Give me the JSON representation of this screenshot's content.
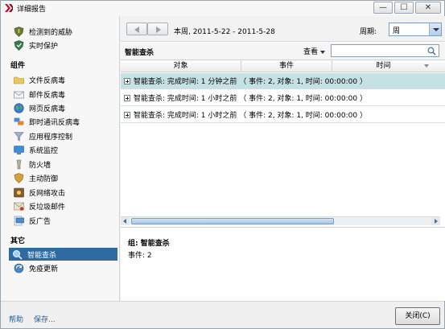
{
  "window": {
    "title": "详细报告"
  },
  "titlebar": {
    "min_glyph": "—",
    "max_glyph": "☐",
    "close_glyph": "✕"
  },
  "sidebar": {
    "top_items": [
      {
        "label": "检测到的威胁",
        "icon": "threat-shield-icon"
      },
      {
        "label": "实时保护",
        "icon": "protection-shield-icon"
      }
    ],
    "components_heading": "组件",
    "components": [
      {
        "label": "文件反病毒",
        "icon": "folder-icon"
      },
      {
        "label": "邮件反病毒",
        "icon": "mail-icon"
      },
      {
        "label": "网页反病毒",
        "icon": "globe-icon"
      },
      {
        "label": "即时通讯反病毒",
        "icon": "chat-icon"
      },
      {
        "label": "应用程序控制",
        "icon": "filter-icon"
      },
      {
        "label": "系统监控",
        "icon": "monitor-icon"
      },
      {
        "label": "防火墙",
        "icon": "firewall-icon"
      },
      {
        "label": "主动防御",
        "icon": "proactive-defense-icon"
      },
      {
        "label": "反网络攻击",
        "icon": "network-attack-icon"
      },
      {
        "label": "反垃圾邮件",
        "icon": "antispam-icon"
      },
      {
        "label": "反广告",
        "icon": "antibanner-icon"
      }
    ],
    "other_heading": "其它",
    "other": [
      {
        "label": "智能查杀",
        "icon": "scan-icon",
        "selected": true
      },
      {
        "label": "免疫更新",
        "icon": "update-icon",
        "selected": false
      }
    ]
  },
  "toolbar": {
    "period": "本周, 2011-5-22 - 2011-5-28",
    "cycle_label": "周期:",
    "cycle_value": "周"
  },
  "section": {
    "title": "智能查杀",
    "view_label": "查看",
    "search_placeholder": ""
  },
  "table": {
    "columns": [
      "对象",
      "事件",
      "时间"
    ],
    "rows": [
      {
        "text": "智能查杀: 完成时间: 1 分钟之前  （ 事件: 2, 对象: 1, 时间: 00:00:00 ）",
        "selected": true
      },
      {
        "text": "智能查杀: 完成时间: 1 小时之前  （ 事件: 2, 对象: 1, 时间: 00:00:00 ）",
        "selected": false
      },
      {
        "text": "智能查杀: 完成时间: 1 小时之前  （ 事件: 2, 对象: 1, 时间: 00:00:00 ）",
        "selected": false
      }
    ]
  },
  "details": {
    "group": "组: 智能查杀",
    "events": "事件: 2"
  },
  "footer": {
    "help": "帮助",
    "save": "保存...",
    "close": "关闭(C)"
  },
  "colors": {
    "selection": "#2f6ba0",
    "row_highlight": "#c6e1e3",
    "link": "#1d5c9a"
  }
}
